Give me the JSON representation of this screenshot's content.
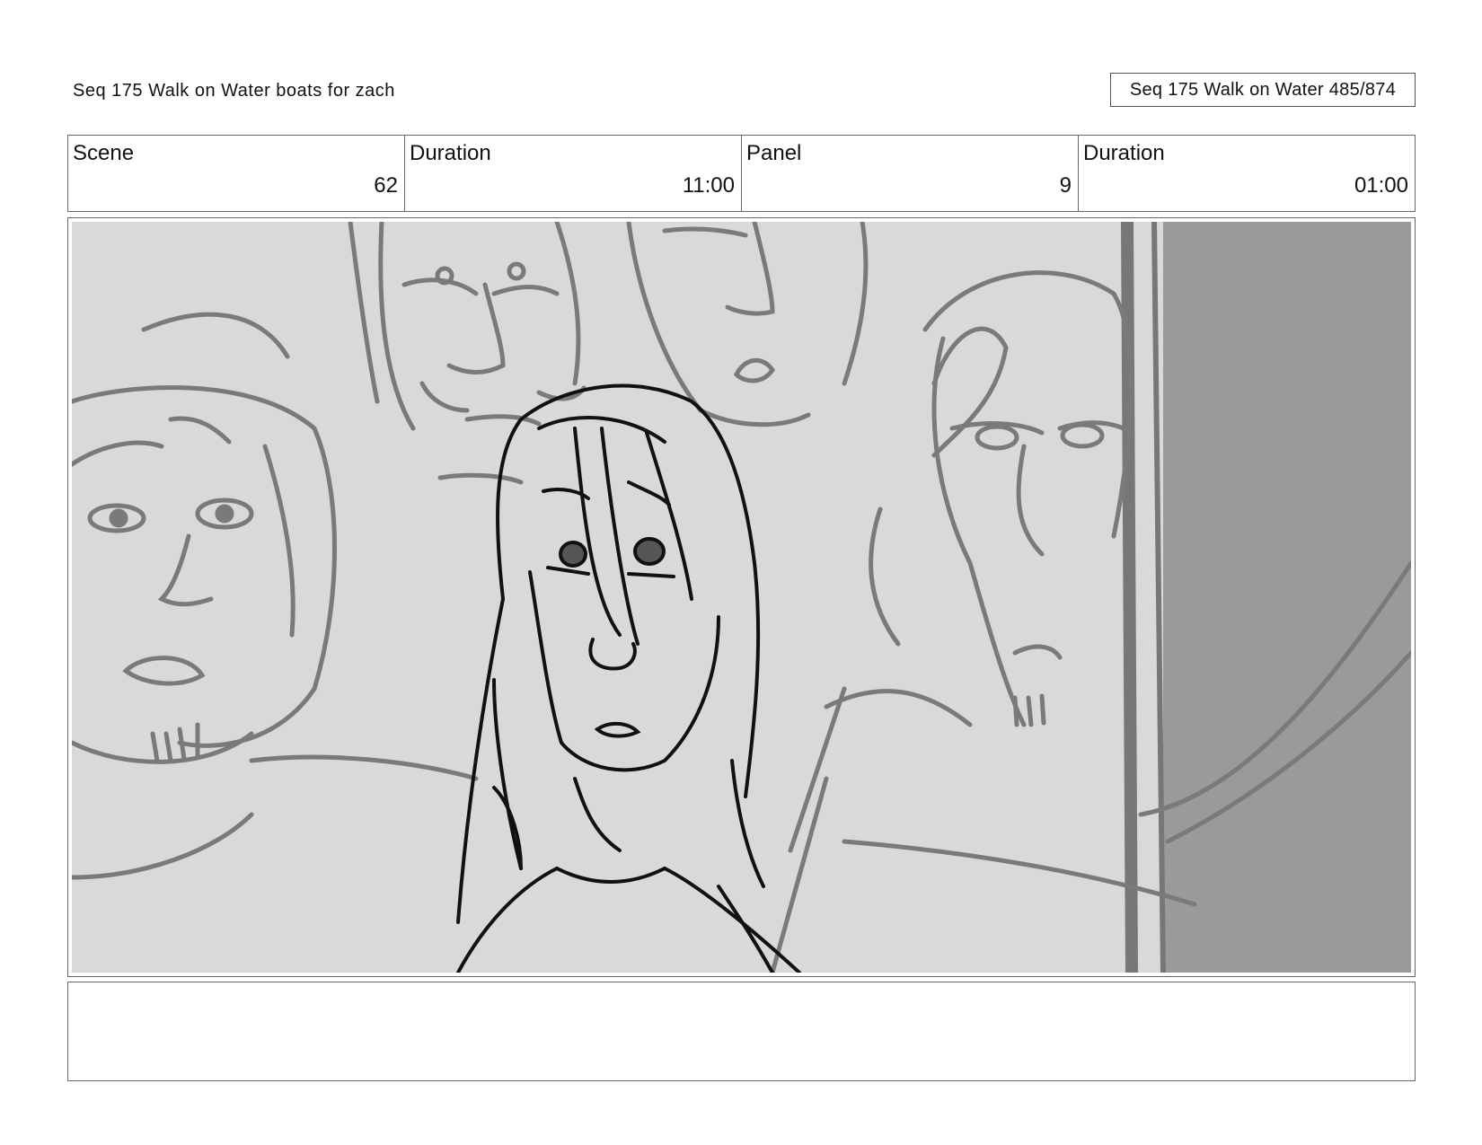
{
  "header": {
    "title": "Seq 175 Walk on Water  boats for zach",
    "page_counter": "Seq 175 Walk on Water 485/874"
  },
  "info": {
    "scene_label": "Scene",
    "scene_value": "62",
    "duration_label": "Duration",
    "duration_value": "11:00",
    "panel_label": "Panel",
    "panel_value": "9",
    "panel_duration_label": "Duration",
    "panel_duration_value": "01:00"
  },
  "panel_image": {
    "description_icon": "storyboard-sketch",
    "colors": {
      "background": "#d9d9d9",
      "sketch_gray": "#7a7a7a",
      "foreground_ink": "#111111",
      "dark_panel": "#9a9a9a"
    }
  },
  "notes": {
    "text": ""
  }
}
